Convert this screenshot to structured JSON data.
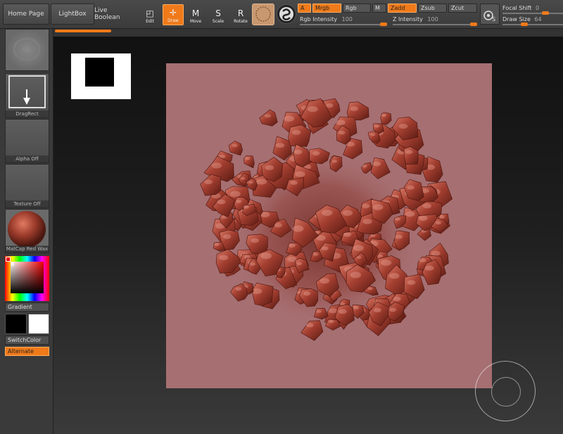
{
  "toolbar": {
    "home_page": "Home Page",
    "lightbox": "LightBox",
    "live_boolean": "Live Boolean",
    "tools": [
      {
        "label": "Edit",
        "glyph": "◰",
        "active": false
      },
      {
        "label": "Draw",
        "glyph": "✛",
        "active": true
      },
      {
        "label": "Move",
        "glyph": "M",
        "active": false
      },
      {
        "label": "Scale",
        "glyph": "S",
        "active": false
      },
      {
        "label": "Rotate",
        "glyph": "R",
        "active": false
      }
    ],
    "a_label": "A",
    "mrgb_label": "Mrgb",
    "rgb_label": "Rgb",
    "m_label": "M",
    "zadd_label": "Zadd",
    "zsub_label": "Zsub",
    "zcut_label": "Zcut",
    "rgb_intensity_label": "Rgb Intensity",
    "rgb_intensity_value": "100",
    "z_intensity_label": "Z Intensity",
    "z_intensity_value": "100",
    "focal_shift_label": "Focal Shift",
    "focal_shift_value": "0",
    "draw_size_label": "Draw Size",
    "draw_size_value": "64"
  },
  "leftpanel": {
    "dragrect_label": "DragRect",
    "alpha_label": "Alpha Off",
    "texture_label": "Texture Off",
    "matcap_label": "MatCap Red Wax",
    "gradient_label": "Gradient",
    "switch_color_label": "SwitchColor",
    "alternate_label": "Alternate"
  },
  "colors": {
    "accent": "#f07a1a",
    "canvas": "#a66f71",
    "sculpt": "#8a2f26"
  }
}
